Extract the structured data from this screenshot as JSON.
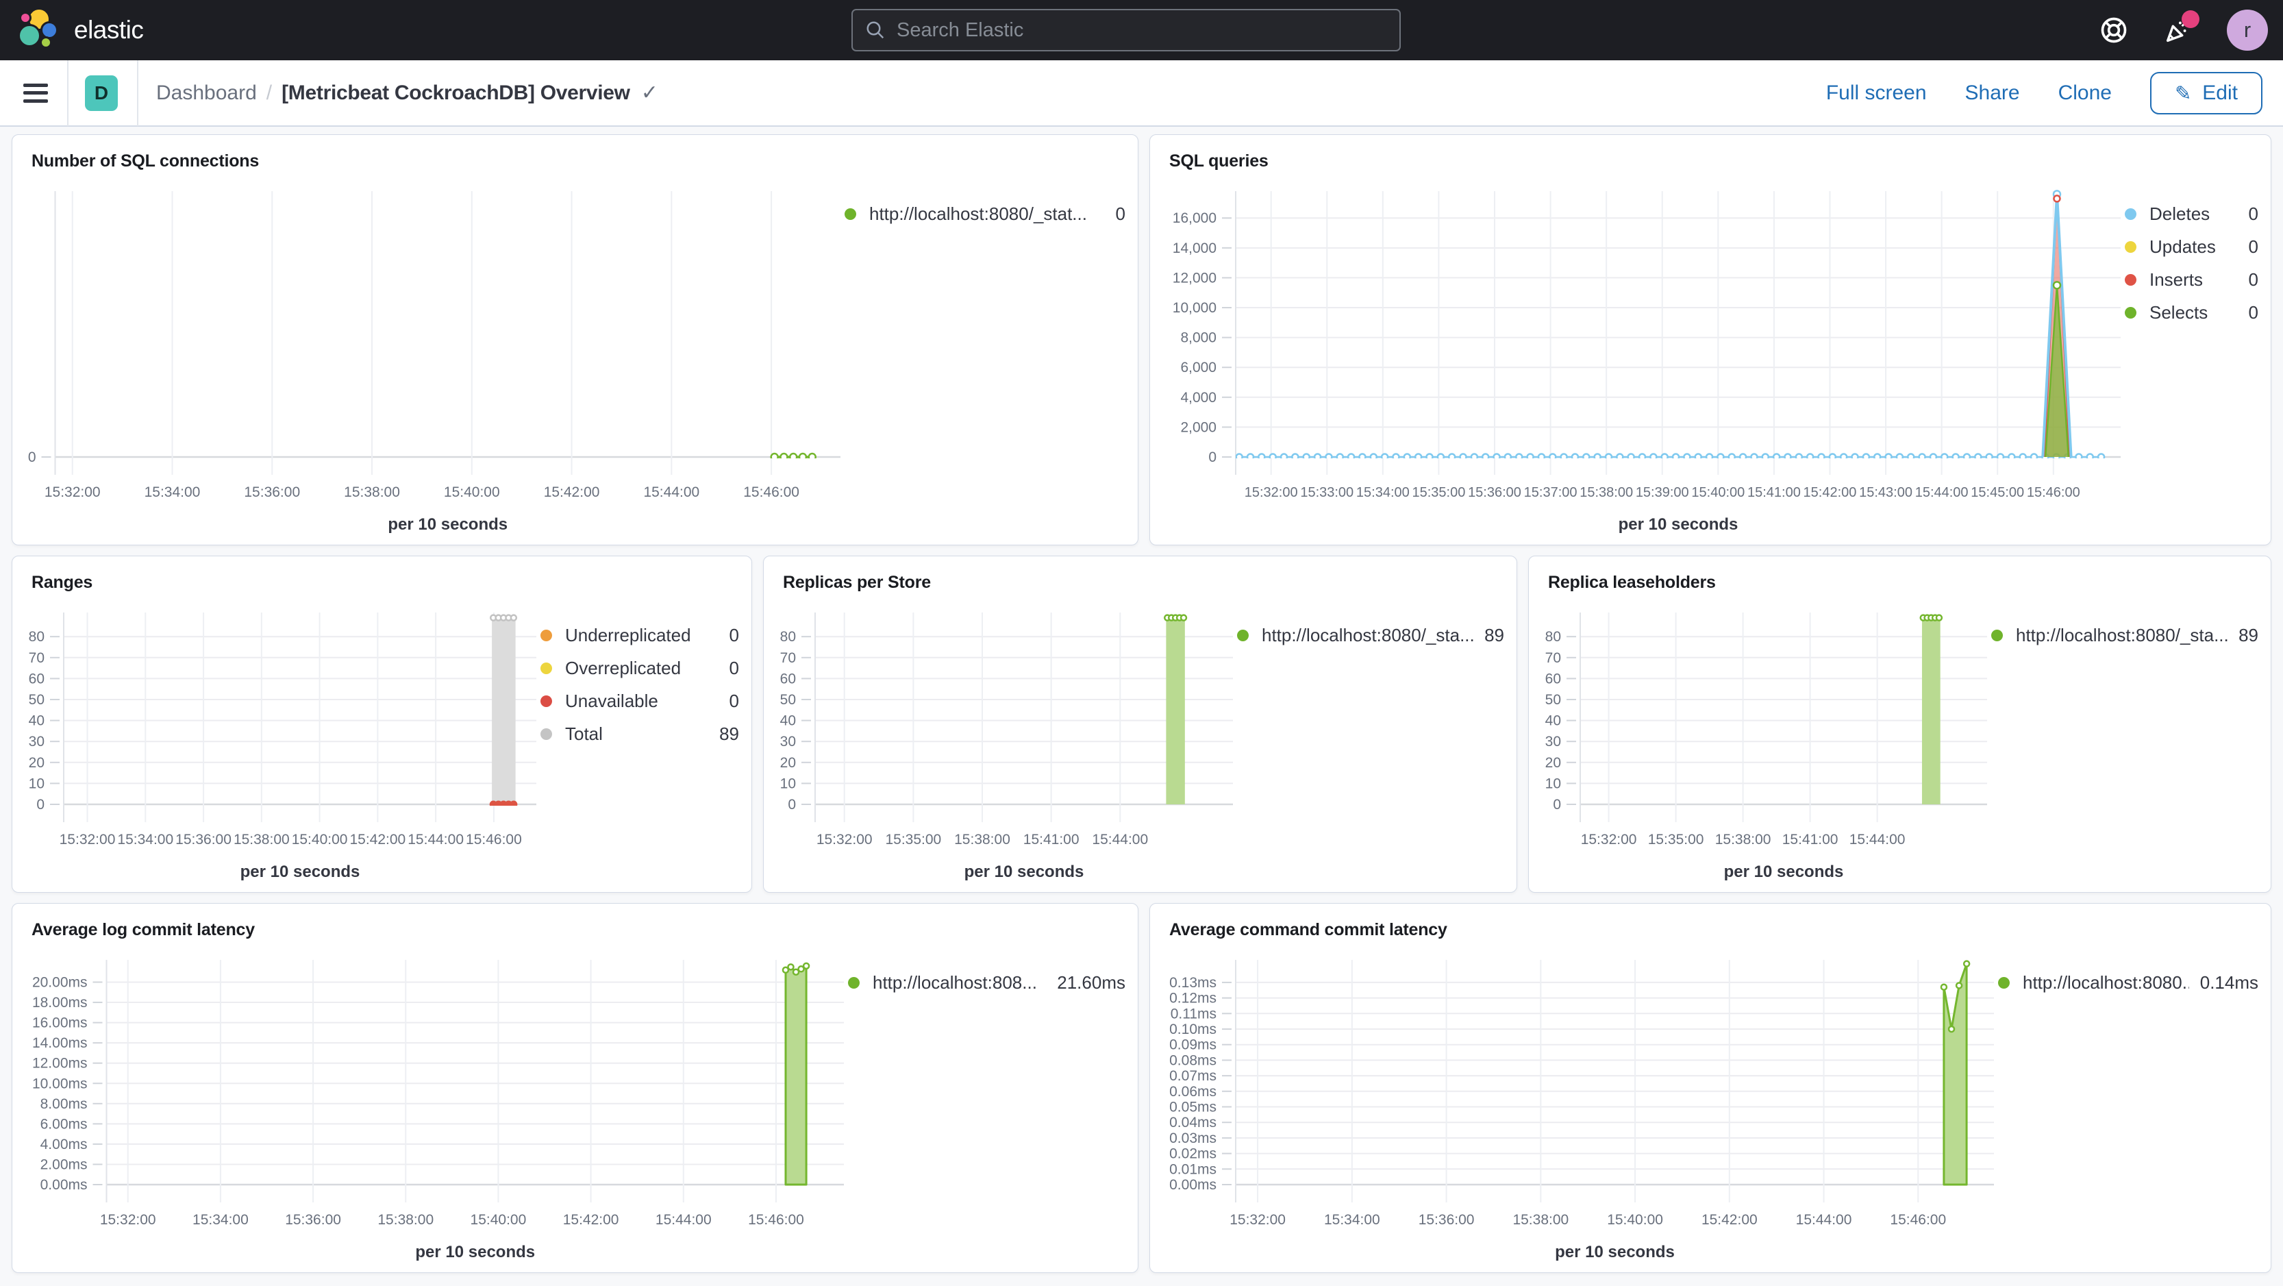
{
  "header": {
    "brand": "elastic",
    "search_placeholder": "Search Elastic",
    "avatar_letter": "r",
    "colors": {
      "header_bg": "#1d1e23",
      "accent_pink": "#e5417e",
      "avatar_bg": "#cfa9de"
    }
  },
  "breadcrumb": {
    "app_badge": "D",
    "root": "Dashboard",
    "separator": "/",
    "current": "[Metricbeat CockroachDB] Overview"
  },
  "toolbar": {
    "full_screen_label": "Full screen",
    "share_label": "Share",
    "clone_label": "Clone",
    "edit_label": "Edit"
  },
  "palette": {
    "green": "#6fb32b",
    "green_area": "#b9da91",
    "blue": "#7fc9ef",
    "yellow": "#edd53e",
    "red": "#df5346",
    "orange": "#ee9d3c",
    "gray": "#c4c4c4",
    "link_blue": "#1f6db5",
    "badge_teal": "#4dc6bb"
  },
  "panels": [
    {
      "title": "Number of SQL connections",
      "legend": [
        {
          "label": "http://localhost:8080/_stat...",
          "value": "0",
          "color": "#6fb32b"
        }
      ],
      "chart_data": {
        "type": "line",
        "xlabel": "per 10 seconds",
        "ylim": [
          0,
          8
        ],
        "x_ticks": [
          "15:32:00",
          "15:34:00",
          "15:36:00",
          "15:38:00",
          "15:40:00",
          "15:42:00",
          "15:44:00",
          "15:46:00"
        ],
        "tick_start": 0.022,
        "tick_end": 0.912,
        "y_ticks": [
          {
            "v": 0,
            "l": "0"
          }
        ],
        "series_note": "single series flat at 0 near 15:46",
        "marks": [
          {
            "t": "poly",
            "pts": [
              [
                0.916,
                0
              ],
              [
                0.928,
                0
              ],
              [
                0.94,
                0
              ],
              [
                0.952,
                0
              ],
              [
                0.964,
                0
              ]
            ],
            "fill": "none",
            "stroke": "#74b62e",
            "sw": 3.5,
            "markers": true,
            "mr": 5
          }
        ]
      }
    },
    {
      "title": "SQL queries",
      "legend": [
        {
          "label": "Deletes",
          "value": "0",
          "color": "#7fc9ef"
        },
        {
          "label": "Updates",
          "value": "0",
          "color": "#edd53e"
        },
        {
          "label": "Inserts",
          "value": "0",
          "color": "#df5346"
        },
        {
          "label": "Selects",
          "value": "0",
          "color": "#6fb32b"
        }
      ],
      "chart_data": {
        "type": "line",
        "xlabel": "per 10 seconds",
        "ylim": [
          0,
          17800
        ],
        "x_ticks": [
          "15:32:00",
          "15:33:00",
          "15:34:00",
          "15:35:00",
          "15:36:00",
          "15:37:00",
          "15:38:00",
          "15:39:00",
          "15:40:00",
          "15:41:00",
          "15:42:00",
          "15:43:00",
          "15:44:00",
          "15:45:00",
          "15:46:00"
        ],
        "tick_start": 0.04,
        "tick_end": 0.924,
        "y_ticks": [
          {
            "v": 0,
            "l": "0"
          },
          {
            "v": 2000,
            "l": "2,000"
          },
          {
            "v": 4000,
            "l": "4,000"
          },
          {
            "v": 6000,
            "l": "6,000"
          },
          {
            "v": 8000,
            "l": "8,000"
          },
          {
            "v": 10000,
            "l": "10,000"
          },
          {
            "v": 12000,
            "l": "12,000"
          },
          {
            "v": 14000,
            "l": "14,000"
          },
          {
            "v": 16000,
            "l": "16,000"
          }
        ],
        "series_note": "Deletes flat 0 dotted line; spike near 15:46: Deletes 17600, Inserts 17300, Selects 11500",
        "marks": [
          {
            "t": "dotline",
            "y": 0,
            "x0": 0.004,
            "x1": 0.978,
            "n": 78,
            "color": "#7fc9ef",
            "r": 4.5,
            "sw": 2.5
          },
          {
            "t": "poly",
            "pts": [
              [
                0.914,
                0
              ],
              [
                0.928,
                17300
              ],
              [
                0.942,
                0
              ]
            ],
            "fill": "rgba(223,83,70,0.5)",
            "stroke": "#df5346",
            "sw": 2
          },
          {
            "t": "poly",
            "pts": [
              [
                0.915,
                0
              ],
              [
                0.928,
                11500
              ],
              [
                0.941,
                0
              ]
            ],
            "fill": "rgba(133,187,66,0.78)",
            "stroke": "#6fb32b",
            "sw": 2.5
          },
          {
            "t": "poly",
            "pts": [
              [
                0.912,
                0
              ],
              [
                0.928,
                17600
              ],
              [
                0.944,
                0
              ]
            ],
            "fill": "none",
            "stroke": "#7fc9ef",
            "sw": 4
          },
          {
            "t": "rings",
            "y": 17600,
            "x0": 0.928,
            "x1": 0.928,
            "n": 1,
            "color": "#7fc9ef",
            "r": 5
          },
          {
            "t": "rings",
            "y": 17300,
            "x0": 0.928,
            "x1": 0.928,
            "n": 1,
            "color": "#df5346",
            "r": 4.5
          },
          {
            "t": "rings",
            "y": 11500,
            "x0": 0.928,
            "x1": 0.928,
            "n": 1,
            "color": "#6fb32b",
            "r": 5
          }
        ]
      }
    },
    {
      "title": "Ranges",
      "legend": [
        {
          "label": "Underreplicated",
          "value": "0",
          "color": "#ee9d3c"
        },
        {
          "label": "Overreplicated",
          "value": "0",
          "color": "#edd53e"
        },
        {
          "label": "Unavailable",
          "value": "0",
          "color": "#db4d44"
        },
        {
          "label": "Total",
          "value": "89",
          "color": "#c4c4c4"
        }
      ],
      "chart_data": {
        "type": "bar",
        "xlabel": "per 10 seconds",
        "ylim": [
          0,
          91.5
        ],
        "x_ticks": [
          "15:32:00",
          "15:34:00",
          "15:36:00",
          "15:38:00",
          "15:40:00",
          "15:42:00",
          "15:44:00",
          "15:46:00"
        ],
        "tick_start": 0.05,
        "tick_end": 0.91,
        "y_ticks": [
          {
            "v": 0,
            "l": "0"
          },
          {
            "v": 10,
            "l": "10"
          },
          {
            "v": 20,
            "l": "20"
          },
          {
            "v": 30,
            "l": "30"
          },
          {
            "v": 40,
            "l": "40"
          },
          {
            "v": 50,
            "l": "50"
          },
          {
            "v": 60,
            "l": "60"
          },
          {
            "v": 70,
            "l": "70"
          },
          {
            "v": 80,
            "l": "80"
          }
        ],
        "series_note": "Total 89 gray bar at 15:46; Unavailable/others 0 (red dots at baseline)",
        "marks": [
          {
            "t": "bar",
            "x0": 0.906,
            "x1": 0.956,
            "v": 89,
            "fill": "#dcdcdc"
          },
          {
            "t": "rings",
            "y": 89,
            "x0": 0.909,
            "x1": 0.952,
            "n": 5,
            "color": "#c2c2c2",
            "r": 4
          },
          {
            "t": "dots",
            "y": 0,
            "x0": 0.909,
            "x1": 0.952,
            "n": 5,
            "color": "#dd5443",
            "r": 5.5
          }
        ]
      }
    },
    {
      "title": "Replicas per Store",
      "legend": [
        {
          "label": "http://localhost:8080/_sta...",
          "value": "89",
          "color": "#6fb32b"
        }
      ],
      "chart_data": {
        "type": "bar",
        "xlabel": "per 10 seconds",
        "ylim": [
          0,
          91.5
        ],
        "x_ticks": [
          "15:32:00",
          "15:35:00",
          "15:38:00",
          "15:41:00",
          "15:44:00"
        ],
        "tick_start": 0.07,
        "tick_end": 0.73,
        "y_ticks": [
          {
            "v": 0,
            "l": "0"
          },
          {
            "v": 10,
            "l": "10"
          },
          {
            "v": 20,
            "l": "20"
          },
          {
            "v": 30,
            "l": "30"
          },
          {
            "v": 40,
            "l": "40"
          },
          {
            "v": 50,
            "l": "50"
          },
          {
            "v": 60,
            "l": "60"
          },
          {
            "v": 70,
            "l": "70"
          },
          {
            "v": 80,
            "l": "80"
          }
        ],
        "series_note": "value 89 green bar near 15:46",
        "marks": [
          {
            "t": "bar",
            "x0": 0.84,
            "x1": 0.885,
            "v": 89,
            "fill": "#b9da91"
          },
          {
            "t": "rings",
            "y": 89,
            "x0": 0.843,
            "x1": 0.882,
            "n": 5,
            "color": "#74b62e",
            "r": 4
          }
        ]
      }
    },
    {
      "title": "Replica leaseholders",
      "legend": [
        {
          "label": "http://localhost:8080/_sta...",
          "value": "89",
          "color": "#6fb32b"
        }
      ],
      "chart_data": {
        "type": "bar",
        "xlabel": "per 10 seconds",
        "ylim": [
          0,
          91.5
        ],
        "x_ticks": [
          "15:32:00",
          "15:35:00",
          "15:38:00",
          "15:41:00",
          "15:44:00"
        ],
        "tick_start": 0.07,
        "tick_end": 0.73,
        "y_ticks": [
          {
            "v": 0,
            "l": "0"
          },
          {
            "v": 10,
            "l": "10"
          },
          {
            "v": 20,
            "l": "20"
          },
          {
            "v": 30,
            "l": "30"
          },
          {
            "v": 40,
            "l": "40"
          },
          {
            "v": 50,
            "l": "50"
          },
          {
            "v": 60,
            "l": "60"
          },
          {
            "v": 70,
            "l": "70"
          },
          {
            "v": 80,
            "l": "80"
          }
        ],
        "series_note": "value 89 green bar near 15:46",
        "marks": [
          {
            "t": "bar",
            "x0": 0.84,
            "x1": 0.885,
            "v": 89,
            "fill": "#b9da91"
          },
          {
            "t": "rings",
            "y": 89,
            "x0": 0.843,
            "x1": 0.882,
            "n": 5,
            "color": "#74b62e",
            "r": 4
          }
        ]
      }
    },
    {
      "title": "Average log commit latency",
      "legend": [
        {
          "label": "http://localhost:808...",
          "value": "21.60ms",
          "color": "#6fb32b"
        }
      ],
      "chart_data": {
        "type": "area",
        "xlabel": "per 10 seconds",
        "ylim": [
          0,
          22.2
        ],
        "x_ticks": [
          "15:32:00",
          "15:34:00",
          "15:36:00",
          "15:38:00",
          "15:40:00",
          "15:42:00",
          "15:44:00",
          "15:46:00"
        ],
        "tick_start": 0.029,
        "tick_end": 0.908,
        "y_ticks": [
          {
            "v": 0,
            "l": "0.00ms"
          },
          {
            "v": 2,
            "l": "2.00ms"
          },
          {
            "v": 4,
            "l": "4.00ms"
          },
          {
            "v": 6,
            "l": "6.00ms"
          },
          {
            "v": 8,
            "l": "8.00ms"
          },
          {
            "v": 10,
            "l": "10.00ms"
          },
          {
            "v": 12,
            "l": "12.00ms"
          },
          {
            "v": 14,
            "l": "14.00ms"
          },
          {
            "v": 16,
            "l": "16.00ms"
          },
          {
            "v": 18,
            "l": "18.00ms"
          },
          {
            "v": 20,
            "l": "20.00ms"
          }
        ],
        "series_note": "green area near 15:46, last value 21.60ms",
        "marks": [
          {
            "t": "poly",
            "pts": [
              [
                0.921,
                21.2
              ],
              [
                0.928,
                21.5
              ],
              [
                0.935,
                21.0
              ],
              [
                0.942,
                21.3
              ],
              [
                0.949,
                21.6
              ]
            ],
            "close": true,
            "fill": "#b9da91",
            "stroke": "#74b62e",
            "sw": 3,
            "markers": true,
            "mr": 4
          }
        ]
      }
    },
    {
      "title": "Average command commit latency",
      "legend": [
        {
          "label": "http://localhost:8080...",
          "value": "0.14ms",
          "color": "#6fb32b"
        }
      ],
      "chart_data": {
        "type": "area",
        "xlabel": "per 10 seconds",
        "ylim": [
          0,
          0.1445
        ],
        "x_ticks": [
          "15:32:00",
          "15:34:00",
          "15:36:00",
          "15:38:00",
          "15:40:00",
          "15:42:00",
          "15:44:00",
          "15:46:00"
        ],
        "tick_start": 0.029,
        "tick_end": 0.9,
        "y_ticks": [
          {
            "v": 0,
            "l": "0.00ms"
          },
          {
            "v": 0.01,
            "l": "0.01ms"
          },
          {
            "v": 0.02,
            "l": "0.02ms"
          },
          {
            "v": 0.03,
            "l": "0.03ms"
          },
          {
            "v": 0.04,
            "l": "0.04ms"
          },
          {
            "v": 0.05,
            "l": "0.05ms"
          },
          {
            "v": 0.06,
            "l": "0.06ms"
          },
          {
            "v": 0.07,
            "l": "0.07ms"
          },
          {
            "v": 0.08,
            "l": "0.08ms"
          },
          {
            "v": 0.09,
            "l": "0.09ms"
          },
          {
            "v": 0.1,
            "l": "0.10ms"
          },
          {
            "v": 0.11,
            "l": "0.11ms"
          },
          {
            "v": 0.12,
            "l": "0.12ms"
          },
          {
            "v": 0.13,
            "l": "0.13ms"
          }
        ],
        "series_note": "green area near 15:46 dipping 0.127 -> 0.10 -> 0.128 -> 0.142, last value 0.14ms",
        "marks": [
          {
            "t": "poly",
            "pts": [
              [
                0.934,
                0.127
              ],
              [
                0.944,
                0.1
              ],
              [
                0.954,
                0.128
              ],
              [
                0.964,
                0.142
              ]
            ],
            "close": true,
            "fill": "#b9da91",
            "stroke": "#74b62e",
            "sw": 3,
            "markers": true,
            "mr": 4
          }
        ]
      }
    }
  ]
}
